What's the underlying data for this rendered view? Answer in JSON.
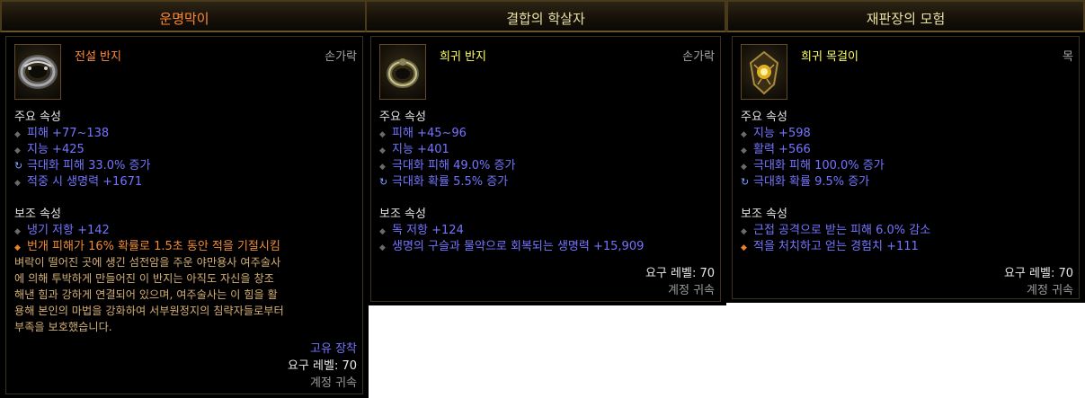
{
  "tooltips": [
    {
      "header": "운명막이",
      "name": "전설 반지",
      "slot": "손가락",
      "primary_title": "주요 속성",
      "primary": [
        "피해 +77~138",
        "지능 +425",
        "극대화 피해 33.0% 증가",
        "적중 시 생명력 +1671"
      ],
      "secondary_title": "보조 속성",
      "secondary": [
        "냉기 저항 +142",
        "번개 피해가 16% 확률로 1.5초 동안 적을 기절시킴"
      ],
      "flavor": [
        "벼락이 떨어진 곳에 생긴 섬전암을 주운 야만용사 여주술사",
        "에 의해 투박하게 만들어진 이 반지는 아직도 자신을 창조",
        "해낸 힘과 강하게 연결되어 있으며, 여주술사는 이 힘을 활",
        "용해 본인의 마법을 강화하여 서부원정지의 침략자들로부터",
        "부족을 보호했습니다."
      ],
      "unique": "고유 장착",
      "level_req": "요구 레벨: 70",
      "bound": "계정 귀속"
    },
    {
      "header": "결합의 학살자",
      "name": "희귀 반지",
      "slot": "손가락",
      "primary_title": "주요 속성",
      "primary": [
        "피해 +45~96",
        "지능 +401",
        "극대화 피해 49.0% 증가",
        "극대화 확률 5.5% 증가"
      ],
      "secondary_title": "보조 속성",
      "secondary": [
        "독 저항 +124",
        "생명의 구슬과 물약으로 회복되는 생명력 +15,909"
      ],
      "level_req": "요구 레벨: 70",
      "bound": "계정 귀속"
    },
    {
      "header": "재판장의 모험",
      "name": "희귀 목걸이",
      "slot": "목",
      "primary_title": "주요 속성",
      "primary": [
        "지능 +598",
        "활력 +566",
        "극대화 피해 100.0% 증가",
        "극대화 확률 9.5% 증가"
      ],
      "secondary_title": "보조 속성",
      "secondary": [
        "근접 공격으로 받는 피해 6.0% 감소",
        "적을 처치하고 얻는 경험치 +111"
      ],
      "level_req": "요구 레벨: 70",
      "bound": "계정 귀속"
    }
  ],
  "colors": {
    "legendary_name": "#ff8a35",
    "rare_name": "#ffff66",
    "magic_stat": "#7474ff",
    "flavor": "#d2ae74",
    "header_legendary": "#ff8a35",
    "header_rare": "#e8e2a0"
  },
  "icons": [
    "legendary-ring-icon",
    "rare-ring-icon",
    "rare-amulet-icon"
  ]
}
